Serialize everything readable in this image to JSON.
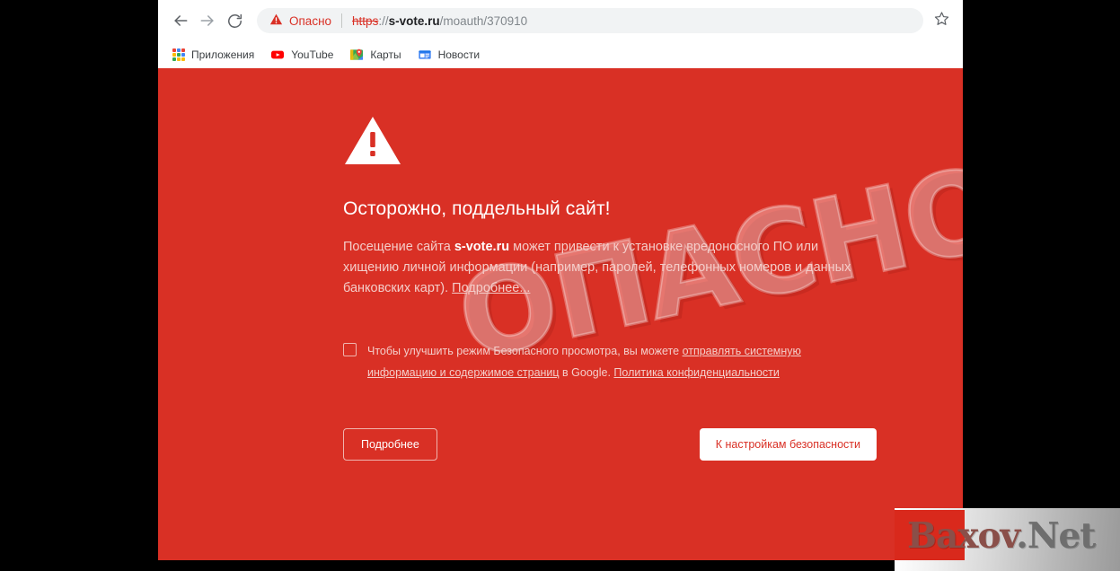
{
  "browser": {
    "nav": {
      "back_icon": "arrow-left-icon",
      "forward_icon": "arrow-right-icon",
      "reload_icon": "reload-icon"
    },
    "omnibox": {
      "security_icon": "danger-triangle-icon",
      "security_label": "Опасно",
      "url_scheme": "https",
      "url_scheme_separator": "://",
      "url_host": "s-vote.ru",
      "url_path": "/moauth/370910",
      "full_url": "https://s-vote.ru/moauth/370910"
    },
    "star_icon": "bookmark-star-icon",
    "bookmarks": [
      {
        "label": "Приложения",
        "icon": "apps-grid-icon"
      },
      {
        "label": "YouTube",
        "icon": "youtube-icon"
      },
      {
        "label": "Карты",
        "icon": "maps-pin-icon"
      },
      {
        "label": "Новости",
        "icon": "news-icon"
      }
    ]
  },
  "interstitial": {
    "icon": "warning-triangle-icon",
    "heading": "Осторожно, поддельный сайт!",
    "paragraph_part1": "Посещение сайта ",
    "paragraph_host": "s-vote.ru",
    "paragraph_part2": " может привести к установке вредоносного ПО или хищению личной информации (например, паролей, телефонных номеров и данных банковских карт). ",
    "paragraph_link": "Подробнее...",
    "optin_part1": "Чтобы улучшить режим Безопасного просмотра, вы можете ",
    "optin_link1": "отправлять системную информацию и содержимое страниц",
    "optin_part2": " в Google. ",
    "optin_link2": "Политика конфиденциальности",
    "checkbox_checked": "false",
    "details_button": "Подробнее",
    "safety_button": "К настройкам безопасности",
    "background_color": "#d93025"
  },
  "watermark": {
    "stamp_text": "ОПАСНО!",
    "logo_text_a": "Baxov",
    "logo_text_b": ".Net"
  }
}
